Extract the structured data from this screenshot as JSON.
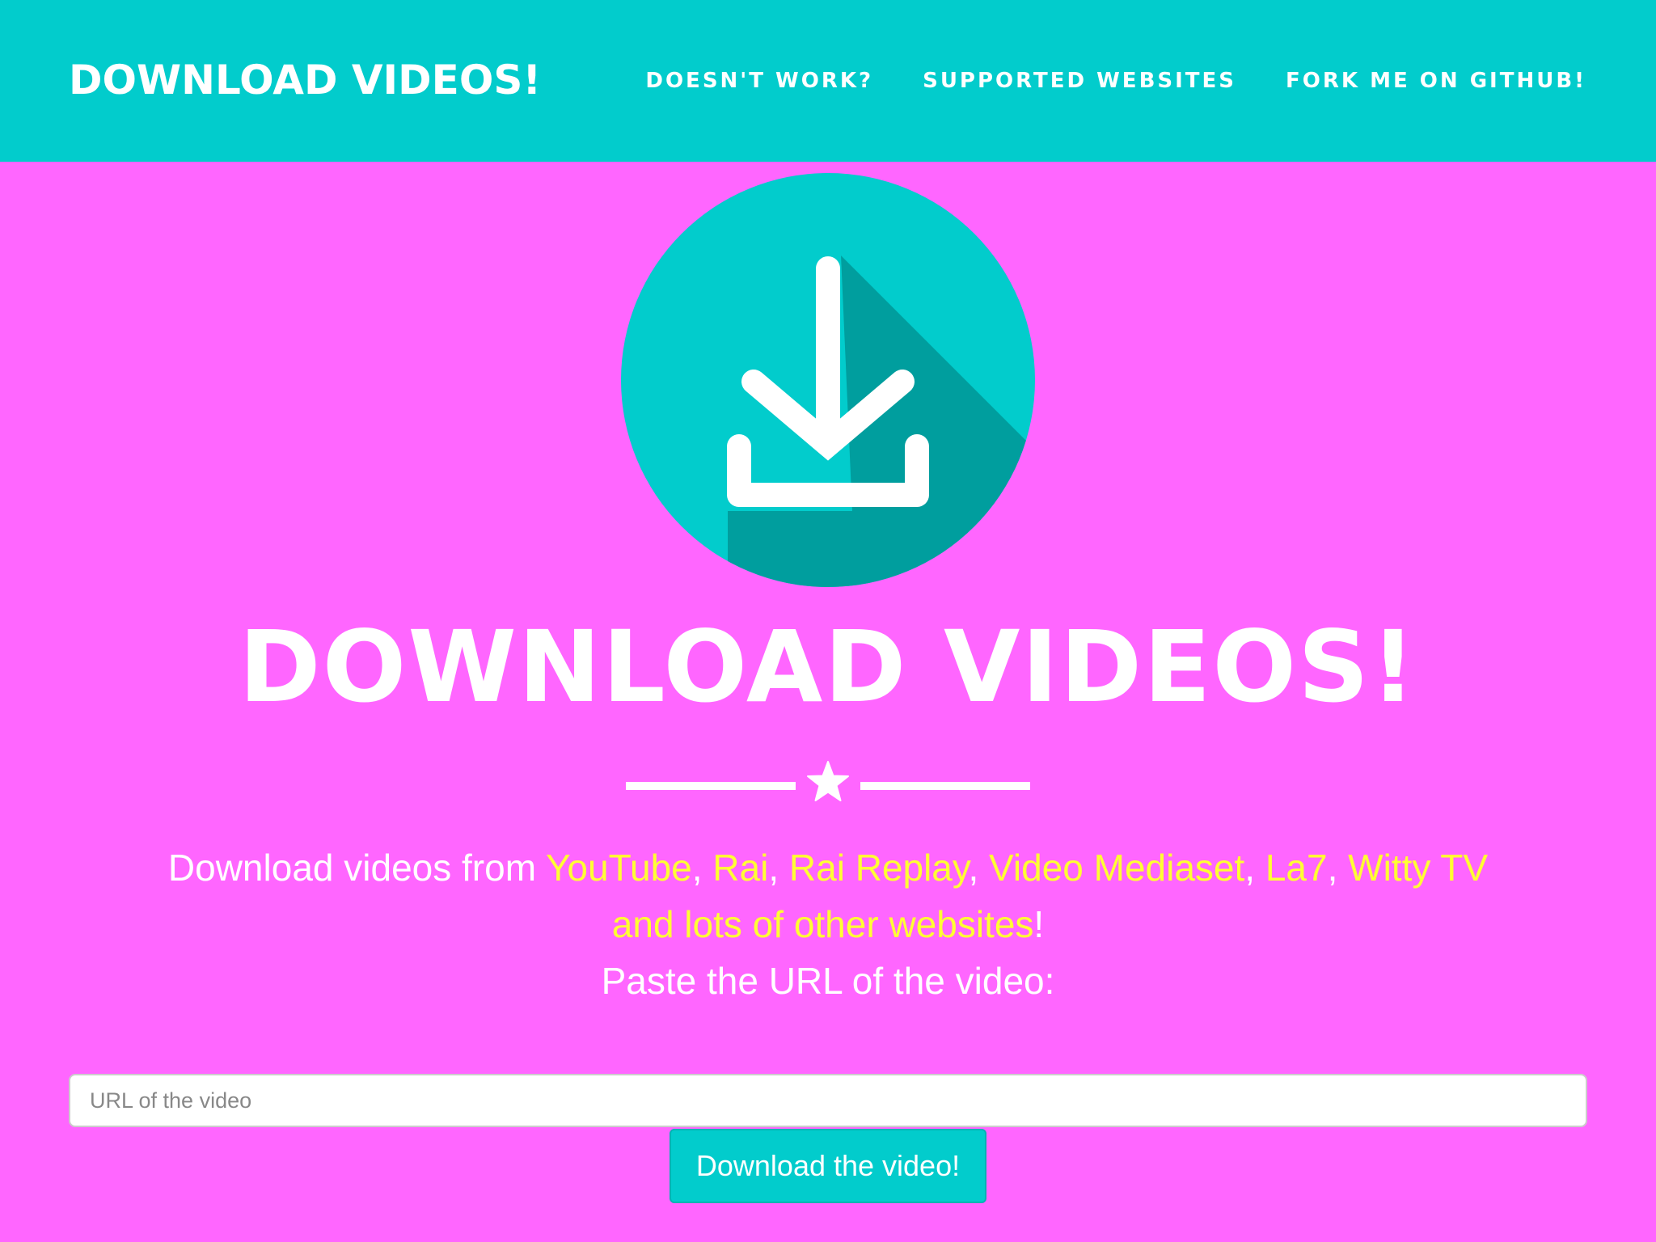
{
  "navbar": {
    "brand": "DOWNLOAD VIDEOS!",
    "links": [
      {
        "label": "DOESN'T WORK?"
      },
      {
        "label": "SUPPORTED WEBSITES"
      },
      {
        "label": "FORK ME ON GITHUB!"
      }
    ]
  },
  "hero": {
    "logo_icon": "download-icon",
    "title": "DOWNLOAD VIDEOS!",
    "divider_icon": "star-icon"
  },
  "description": {
    "prefix": "Download videos from ",
    "sites": [
      "YouTube",
      "Rai",
      "Rai Replay",
      "Video Mediaset",
      "La7",
      "Witty TV and lots of other websites"
    ],
    "separator": ", ",
    "suffix": "!",
    "instruction": "Paste the URL of the video:"
  },
  "form": {
    "url_placeholder": "URL of the video",
    "url_value": "",
    "submit_label": "Download the video!"
  },
  "colors": {
    "background": "#ff66ff",
    "primary": "#02cccc",
    "highlight": "#ffff33",
    "text": "#ffffff"
  }
}
